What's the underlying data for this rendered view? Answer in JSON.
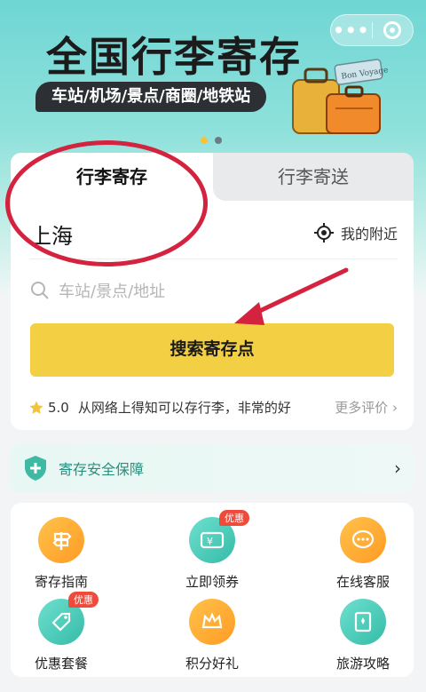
{
  "capsule": {
    "more_glyph": "•••",
    "target_icon": "target-icon"
  },
  "banner": {
    "title": "全国行李寄存",
    "subtitle": "车站/机场/景点/商圈/地铁站",
    "luggage_text": "Bon Voyage"
  },
  "tabs": [
    {
      "label": "行李寄存",
      "active": true
    },
    {
      "label": "行李寄送",
      "active": false
    }
  ],
  "location": {
    "city": "上海",
    "nearby_label": "我的附近"
  },
  "search": {
    "placeholder": "车站/景点/地址",
    "button_label": "搜索寄存点"
  },
  "review": {
    "score": "5.0",
    "text": "从网络上得知可以存行李，非常的好",
    "more_label": "更多评价"
  },
  "safety": {
    "label": "寄存安全保障"
  },
  "services": [
    {
      "label": "寄存指南",
      "icon": "signpost-icon",
      "badge": ""
    },
    {
      "label": "立即领券",
      "icon": "coupon-icon",
      "badge": "优惠"
    },
    {
      "label": "在线客服",
      "icon": "chat-icon",
      "badge": ""
    },
    {
      "label": "优惠套餐",
      "icon": "tag-icon",
      "badge": "优惠"
    },
    {
      "label": "积分好礼",
      "icon": "crown-icon",
      "badge": ""
    },
    {
      "label": "旅游攻略",
      "icon": "guide-book-icon",
      "badge": ""
    }
  ],
  "colors": {
    "accent_yellow": "#f3cf44",
    "teal": "#35bba8",
    "orange": "#ff9b25",
    "annotation_red": "#d4233e"
  }
}
